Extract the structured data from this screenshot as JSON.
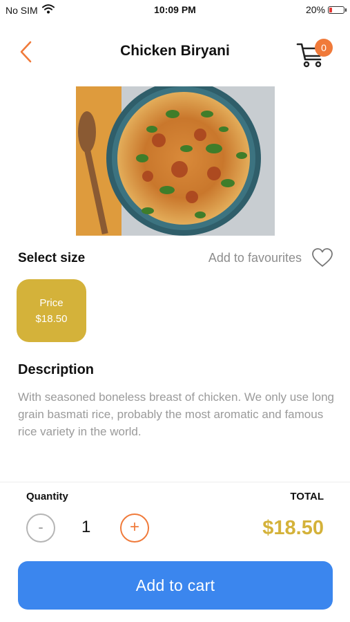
{
  "status_bar": {
    "carrier": "No SIM",
    "time": "10:09 PM",
    "battery": "20%",
    "battery_level": 0.2,
    "battery_color": "#e53935"
  },
  "header": {
    "title": "Chicken Biryani",
    "back_icon": "chevron-left-icon",
    "cart_icon": "shopping-cart-icon",
    "cart_count": "0"
  },
  "product": {
    "image": "chicken-biryani-bowl",
    "select_size_label": "Select size",
    "favourites_label": "Add to favourites",
    "favourite_icon": "heart-outline-icon",
    "size_option": {
      "label": "Price",
      "price": "$18.50",
      "selected": true
    }
  },
  "description": {
    "title": "Description",
    "text": "With seasoned boneless breast of chicken. We only use long grain basmati rice, probably the most aromatic and famous rice variety in the world."
  },
  "order": {
    "quantity_label": "Quantity",
    "total_label": "TOTAL",
    "minus_label": "-",
    "plus_label": "+",
    "quantity": "1",
    "total": "$18.50",
    "add_to_cart_label": "Add to cart"
  },
  "colors": {
    "accent_orange": "#f07a3a",
    "gold": "#d4b23a",
    "primary_blue": "#3b86ee"
  }
}
